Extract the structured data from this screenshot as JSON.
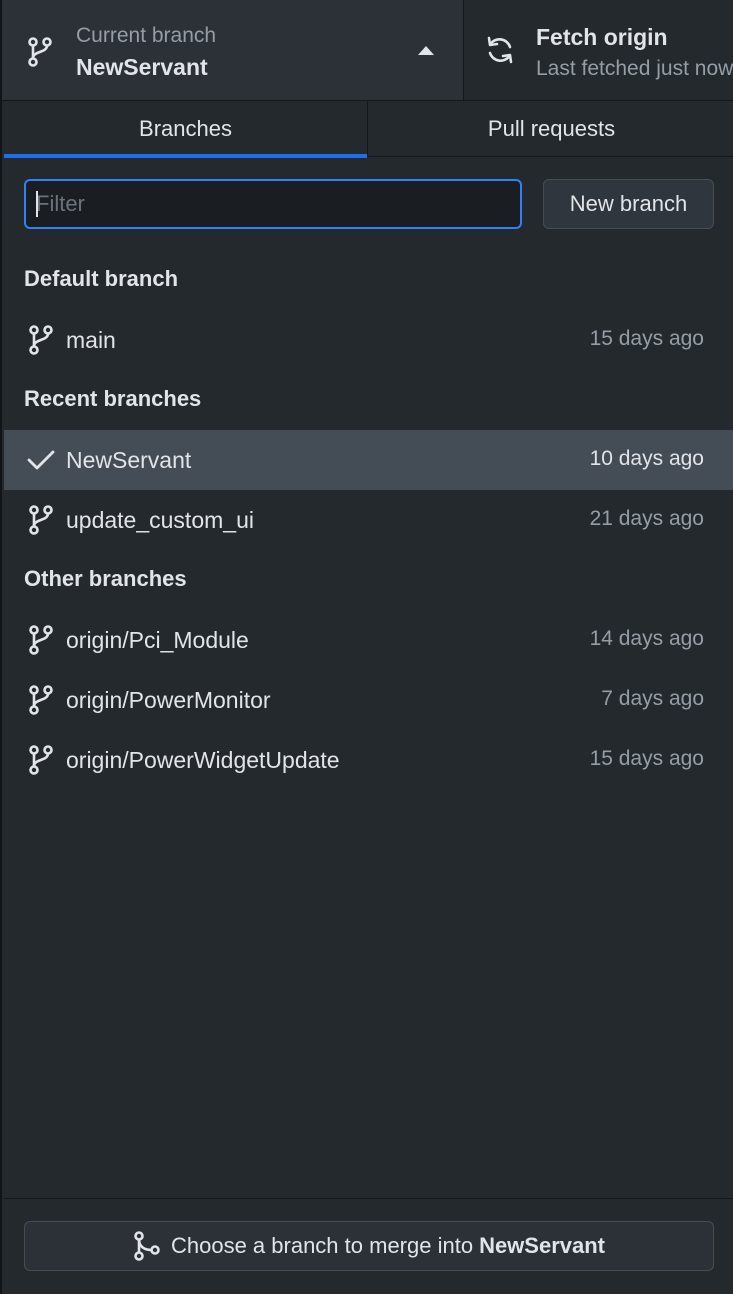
{
  "toolbar": {
    "current_branch_caption": "Current branch",
    "current_branch_value": "NewServant",
    "fetch_caption": "Fetch origin",
    "fetch_sub": "Last fetched just now"
  },
  "tabs": [
    {
      "label": "Branches",
      "active": true
    },
    {
      "label": "Pull requests",
      "active": false
    }
  ],
  "filter": {
    "placeholder": "Filter",
    "value": ""
  },
  "new_branch_label": "New branch",
  "sections": {
    "default": {
      "title": "Default branch",
      "items": [
        {
          "name": "main",
          "time": "15 days ago",
          "icon": "git-branch-icon"
        }
      ]
    },
    "recent": {
      "title": "Recent branches",
      "items": [
        {
          "name": "NewServant",
          "time": "10 days ago",
          "icon": "check-icon",
          "selected": true
        },
        {
          "name": "update_custom_ui",
          "time": "21 days ago",
          "icon": "git-branch-icon"
        }
      ]
    },
    "other": {
      "title": "Other branches",
      "items": [
        {
          "name": "origin/Pci_Module",
          "time": "14 days ago",
          "icon": "git-branch-icon"
        },
        {
          "name": "origin/PowerMonitor",
          "time": "7 days ago",
          "icon": "git-branch-icon"
        },
        {
          "name": "origin/PowerWidgetUpdate",
          "time": "15 days ago",
          "icon": "git-branch-icon"
        }
      ]
    }
  },
  "footer": {
    "merge_prefix": "Choose a branch to merge into",
    "merge_target": "NewServant"
  },
  "colors": {
    "background": "#24292e",
    "accent": "#1f6feb",
    "selected_row": "#444c56"
  }
}
